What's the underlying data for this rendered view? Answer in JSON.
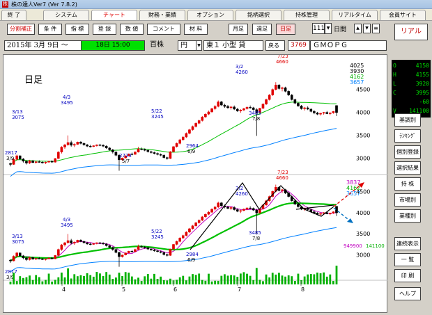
{
  "titlebar": {
    "app_icon": "株",
    "title": "株の達人Ver7 (Ver 7.8.2)"
  },
  "menu": {
    "tabs": [
      "終 了",
      "システム",
      "チャート",
      "財務・業績",
      "オプション",
      "銘柄選択",
      "持株管理",
      "リアルタイム",
      "会員サイト"
    ],
    "active": 2
  },
  "toolbar": {
    "buttons_left": [
      "分割補正",
      "条 件",
      "指 標",
      "登 録",
      "数 値",
      "コメント",
      "材 料"
    ],
    "buttons_period": [
      "月足",
      "週足",
      "日足"
    ],
    "active_period": 2,
    "bar_count": "111",
    "bar_count_unit": "日間",
    "right_button": "リアル"
  },
  "infobar": {
    "date": "2015年 3月 9日 ～",
    "range_box": "18日 15:00",
    "unit_label": "百株",
    "currency": "円",
    "market": "東１ 小型 貸",
    "back_button": "戻る",
    "code": "3769",
    "name": "ＧＭＯＰＧ"
  },
  "ohlc": [
    {
      "k": "O",
      "v": "4150",
      "color": "#00e000"
    },
    {
      "k": "H",
      "v": "4155",
      "color": "#00e000"
    },
    {
      "k": "L",
      "v": "3920",
      "color": "#00e000"
    },
    {
      "k": "C",
      "v": "3995",
      "color": "#00e000"
    },
    {
      "k": "",
      "v": "-60",
      "color": "#00e000"
    },
    {
      "k": "V",
      "v": "141100",
      "color": "#00e000"
    }
  ],
  "side_buttons": [
    "基調別",
    "ﾗﾝｷﾝｸﾞ",
    "個別登録",
    "選択結果",
    "持 株",
    "市場別",
    "業種別",
    "連続表示",
    "一 覧",
    "印 刷",
    "ヘルプ"
  ],
  "chart_data": {
    "type": "candlestick",
    "label_mode": "日足",
    "upper_price_ticks": [
      "4500",
      "4000",
      "3500",
      "3000"
    ],
    "upper_top_labels": [
      "4025",
      "3930",
      "4162",
      "3657"
    ],
    "upper_annotations": [
      "3/13",
      "3075",
      "4/3",
      "3495",
      "5/22",
      "3245",
      "2723",
      "5/7",
      "2964",
      "6/9",
      "3/2",
      "4260",
      "7/23",
      "4660",
      "3485",
      "7/8",
      "2817",
      "3/9"
    ],
    "lower_price_ticks": [
      "4500",
      "4000",
      "3500",
      "3000"
    ],
    "lower_top_labels": [
      "3837",
      "4162",
      "3657"
    ],
    "lower_annotations": [
      "3/13",
      "3075",
      "4/3",
      "3495",
      "5/22",
      "3245",
      "2984",
      "6/9",
      "3/2",
      "4260",
      "7/23",
      "4660",
      "3485",
      "7/8",
      "2817",
      "3/9"
    ],
    "lower_bottom_values": [
      "949900",
      "141100"
    ],
    "x_month_ticks": [
      "4",
      "5",
      "6",
      "7",
      "8"
    ],
    "ylim": [
      2700,
      4800
    ],
    "candles": [
      [
        2880,
        2900,
        2817,
        2860
      ],
      [
        2860,
        2990,
        2850,
        2970
      ],
      [
        2970,
        3075,
        2950,
        3050
      ],
      [
        3050,
        3060,
        2960,
        2980
      ],
      [
        2980,
        3000,
        2900,
        2930
      ],
      [
        2930,
        2950,
        2860,
        2890
      ],
      [
        2890,
        2960,
        2870,
        2940
      ],
      [
        2940,
        2960,
        2890,
        2900
      ],
      [
        2900,
        2930,
        2880,
        2920
      ],
      [
        2920,
        2950,
        2900,
        2910
      ],
      [
        2910,
        2930,
        2880,
        2900
      ],
      [
        2900,
        2920,
        2870,
        2910
      ],
      [
        2910,
        2940,
        2900,
        2930
      ],
      [
        2930,
        2950,
        2900,
        2910
      ],
      [
        2910,
        3000,
        2900,
        2990
      ],
      [
        2990,
        3150,
        2980,
        3130
      ],
      [
        3130,
        3260,
        3100,
        3240
      ],
      [
        3240,
        3310,
        3200,
        3290
      ],
      [
        3290,
        3495,
        3270,
        3340
      ],
      [
        3340,
        3380,
        3250,
        3280
      ],
      [
        3280,
        3320,
        3240,
        3300
      ],
      [
        3300,
        3360,
        3290,
        3350
      ],
      [
        3350,
        3370,
        3300,
        3320
      ],
      [
        3320,
        3340,
        3270,
        3290
      ],
      [
        3290,
        3310,
        3240,
        3260
      ],
      [
        3260,
        3290,
        3230,
        3250
      ],
      [
        3250,
        3280,
        3240,
        3270
      ],
      [
        3270,
        3300,
        3250,
        3290
      ],
      [
        3290,
        3310,
        3260,
        3280
      ],
      [
        3280,
        3300,
        3240,
        3260
      ],
      [
        3260,
        3280,
        3200,
        3220
      ],
      [
        3220,
        3240,
        3160,
        3180
      ],
      [
        3180,
        3200,
        3100,
        3130
      ],
      [
        3130,
        3150,
        3040,
        3060
      ],
      [
        3060,
        3080,
        2723,
        2960
      ],
      [
        2960,
        3010,
        2940,
        3000
      ],
      [
        3000,
        3060,
        2990,
        3050
      ],
      [
        3050,
        3100,
        3040,
        3090
      ],
      [
        3090,
        3120,
        3060,
        3080
      ],
      [
        3080,
        3150,
        3070,
        3130
      ],
      [
        3130,
        3245,
        3120,
        3200
      ],
      [
        3200,
        3230,
        3170,
        3190
      ],
      [
        3190,
        3210,
        3150,
        3170
      ],
      [
        3170,
        3190,
        3120,
        3140
      ],
      [
        3140,
        3160,
        3100,
        3120
      ],
      [
        3120,
        3140,
        3080,
        3100
      ],
      [
        3100,
        3120,
        3060,
        3080
      ],
      [
        3080,
        3100,
        3040,
        3060
      ],
      [
        3060,
        3080,
        2990,
        3010
      ],
      [
        3010,
        3030,
        2964,
        2990
      ],
      [
        2990,
        3150,
        2980,
        3140
      ],
      [
        3140,
        3260,
        3130,
        3250
      ],
      [
        3250,
        3340,
        3230,
        3320
      ],
      [
        3320,
        3420,
        3300,
        3400
      ],
      [
        3400,
        3480,
        3380,
        3460
      ],
      [
        3460,
        3560,
        3440,
        3540
      ],
      [
        3540,
        3640,
        3520,
        3620
      ],
      [
        3620,
        3710,
        3600,
        3690
      ],
      [
        3690,
        3780,
        3670,
        3760
      ],
      [
        3760,
        3840,
        3740,
        3820
      ],
      [
        3820,
        3920,
        3800,
        3900
      ],
      [
        3900,
        3980,
        3880,
        3960
      ],
      [
        3960,
        4040,
        3940,
        4010
      ],
      [
        4010,
        4100,
        3990,
        4080
      ],
      [
        4080,
        4160,
        4050,
        4130
      ],
      [
        4130,
        4260,
        4110,
        4230
      ],
      [
        4230,
        4250,
        4140,
        4160
      ],
      [
        4160,
        4190,
        4100,
        4130
      ],
      [
        4130,
        4160,
        4080,
        4100
      ],
      [
        4100,
        4140,
        4060,
        4120
      ],
      [
        4120,
        4150,
        4050,
        4070
      ],
      [
        4070,
        4100,
        4010,
        4030
      ],
      [
        4030,
        4070,
        3990,
        4050
      ],
      [
        4050,
        4100,
        4030,
        4080
      ],
      [
        4080,
        4130,
        4060,
        4110
      ],
      [
        4110,
        4150,
        4080,
        4100
      ],
      [
        4100,
        4120,
        4040,
        4060
      ],
      [
        4060,
        4090,
        3485,
        3990
      ],
      [
        3990,
        4100,
        3980,
        4090
      ],
      [
        4090,
        4200,
        4070,
        4180
      ],
      [
        4180,
        4300,
        4160,
        4280
      ],
      [
        4280,
        4400,
        4260,
        4380
      ],
      [
        4380,
        4520,
        4360,
        4500
      ],
      [
        4500,
        4660,
        4480,
        4600
      ],
      [
        4600,
        4620,
        4500,
        4520
      ],
      [
        4520,
        4560,
        4460,
        4540
      ],
      [
        4540,
        4560,
        4440,
        4460
      ],
      [
        4460,
        4480,
        4360,
        4380
      ],
      [
        4380,
        4400,
        4260,
        4280
      ],
      [
        4280,
        4300,
        4180,
        4200
      ],
      [
        4200,
        4220,
        4120,
        4140
      ],
      [
        4140,
        4160,
        4060,
        4080
      ],
      [
        4080,
        4120,
        4040,
        4100
      ],
      [
        4100,
        4130,
        4050,
        4070
      ],
      [
        4070,
        4090,
        4000,
        4020
      ],
      [
        4020,
        4050,
        3960,
        3990
      ],
      [
        3990,
        4010,
        3940,
        3960
      ],
      [
        3960,
        3990,
        3930,
        3980
      ],
      [
        3980,
        4010,
        3950,
        4000
      ],
      [
        4000,
        4030,
        3960,
        3970
      ],
      [
        3970,
        4000,
        3940,
        3990
      ],
      [
        3990,
        4030,
        3970,
        4020
      ],
      [
        4150,
        4155,
        3920,
        3995
      ]
    ]
  },
  "colors": {
    "up": "#e00000",
    "down": "#000000",
    "ma_short": "#c000c0",
    "ma_mid": "#00c000",
    "ma_long": "#0080ff",
    "volume": "#00b000",
    "trend": "#000000",
    "arrow_up": "#e00000",
    "arrow_down": "#0070c0"
  }
}
